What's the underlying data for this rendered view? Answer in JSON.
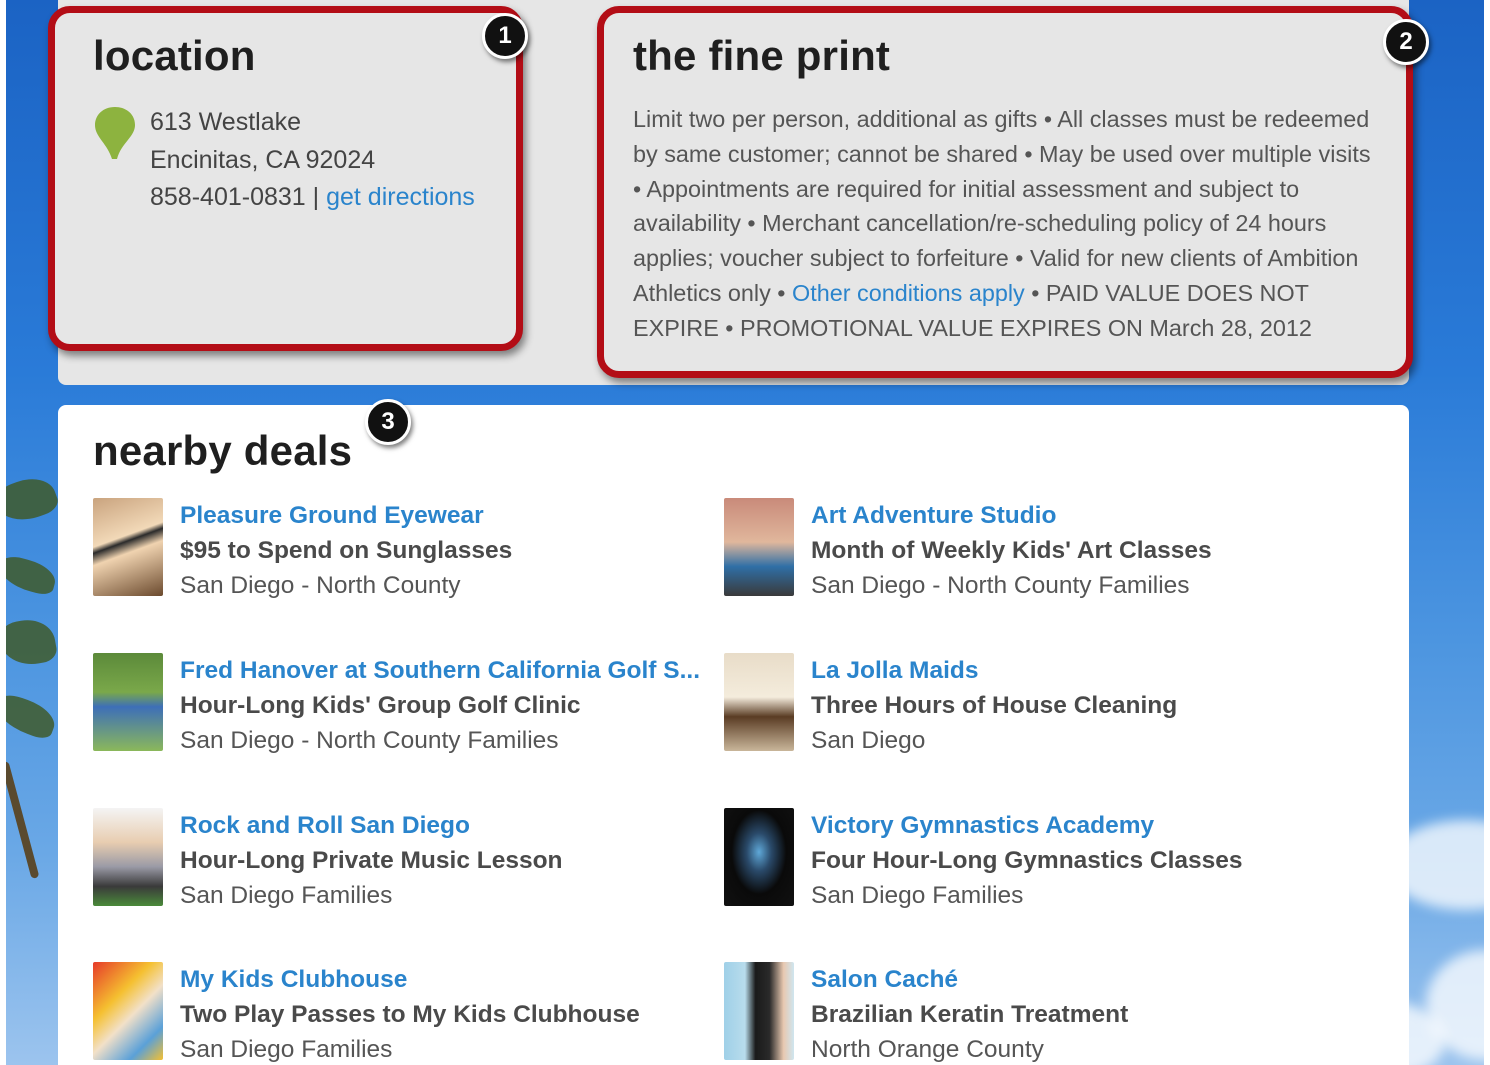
{
  "location": {
    "heading": "location",
    "address_line1": "613 Westlake",
    "address_line2": "Encinitas, CA 92024",
    "phone": "858-401-0831",
    "separator": "|",
    "directions_link": "get directions",
    "pin_color": "#8db33f"
  },
  "fine_print": {
    "heading": "the fine print",
    "text_before_link": "Limit two per person, additional as gifts • All classes must be redeemed by same customer; cannot be shared • May be used over multiple visits • Appointments are required for initial assessment and subject to availability • Merchant cancellation/re-scheduling policy of 24 hours applies; voucher subject to forfeiture • Valid for new clients of Ambition Athletics only • ",
    "link_text": "Other conditions apply",
    "text_after_link": " • PAID VALUE DOES NOT EXPIRE • PROMOTIONAL VALUE EXPIRES ON March 28, 2012"
  },
  "markers": [
    "1",
    "2",
    "3"
  ],
  "nearby": {
    "heading": "nearby deals",
    "deals": [
      {
        "name": "Pleasure Ground Eyewear",
        "title": "$95 to Spend on Sunglasses",
        "area": "San Diego - North County"
      },
      {
        "name": "Art Adventure Studio",
        "title": "Month of Weekly Kids' Art Classes",
        "area": "San Diego - North County Families"
      },
      {
        "name": "Fred Hanover at Southern California Golf S...",
        "title": "Hour-Long Kids' Group Golf Clinic",
        "area": "San Diego - North County Families"
      },
      {
        "name": "La Jolla Maids",
        "title": "Three Hours of House Cleaning",
        "area": "San Diego"
      },
      {
        "name": "Rock and Roll San Diego",
        "title": "Hour-Long Private Music Lesson",
        "area": "San Diego Families"
      },
      {
        "name": "Victory Gymnastics Academy",
        "title": "Four Hour-Long Gymnastics Classes",
        "area": "San Diego Families"
      },
      {
        "name": "My Kids Clubhouse",
        "title": "Two Play Passes to My Kids Clubhouse",
        "area": "San Diego Families"
      },
      {
        "name": "Salon Caché",
        "title": "Brazilian Keratin Treatment",
        "area": "North Orange County"
      }
    ]
  },
  "colors": {
    "highlight_border": "#b30d16",
    "link": "#2a84cc",
    "panel_gray": "#e6e6e6"
  }
}
